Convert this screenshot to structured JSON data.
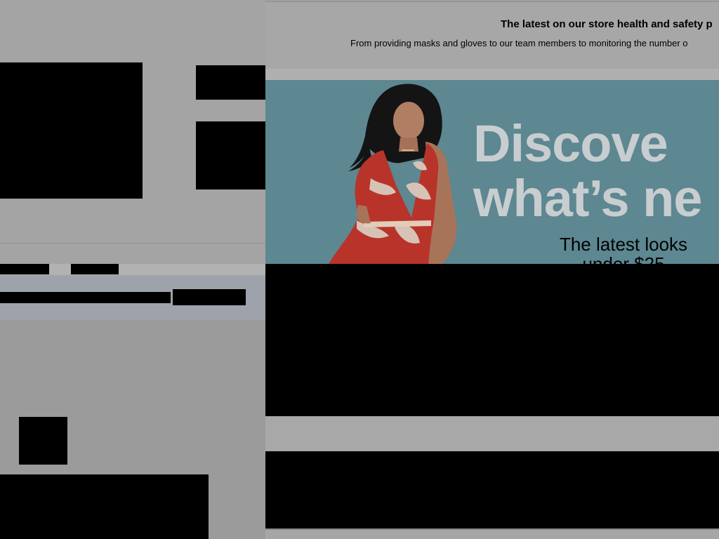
{
  "notice": {
    "title": "The latest on our store health and safety p",
    "body": "From providing masks and gloves to our team members to monitoring the number o"
  },
  "hero": {
    "headline_line1": "Discove",
    "headline_line2": "what’s ne",
    "subtext_line1": "The latest looks",
    "subtext_line2": "under $25"
  },
  "colors": {
    "hero_background": "#5d8791",
    "headline": "#c8cdcf",
    "dress_red": "#b8342b",
    "dim_overlay": "#a2a2a2"
  }
}
